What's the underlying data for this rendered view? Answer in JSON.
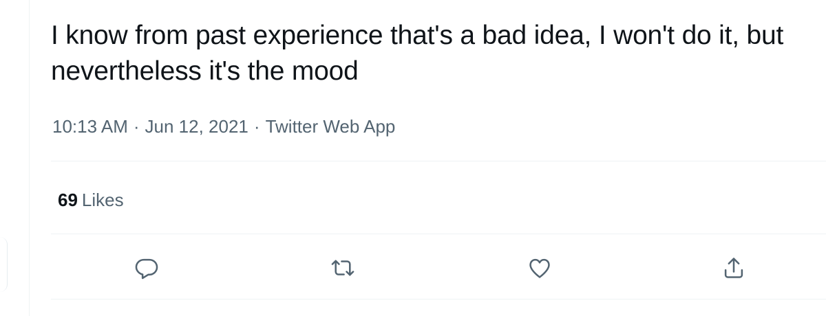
{
  "tweet": {
    "text": "I know from past experience that's a bad idea, I won't do it, but nevertheless it's the mood",
    "time": "10:13 AM",
    "separator": "·",
    "date": "Jun 12, 2021",
    "source": "Twitter Web App"
  },
  "stats": {
    "likes_count": "69",
    "likes_label": "Likes"
  },
  "actions": {
    "reply_icon": "reply-icon",
    "retweet_icon": "retweet-icon",
    "like_icon": "heart-icon",
    "share_icon": "share-icon"
  },
  "colors": {
    "text": "#0f1419",
    "secondary": "#536471",
    "divider": "#eff3f4"
  }
}
